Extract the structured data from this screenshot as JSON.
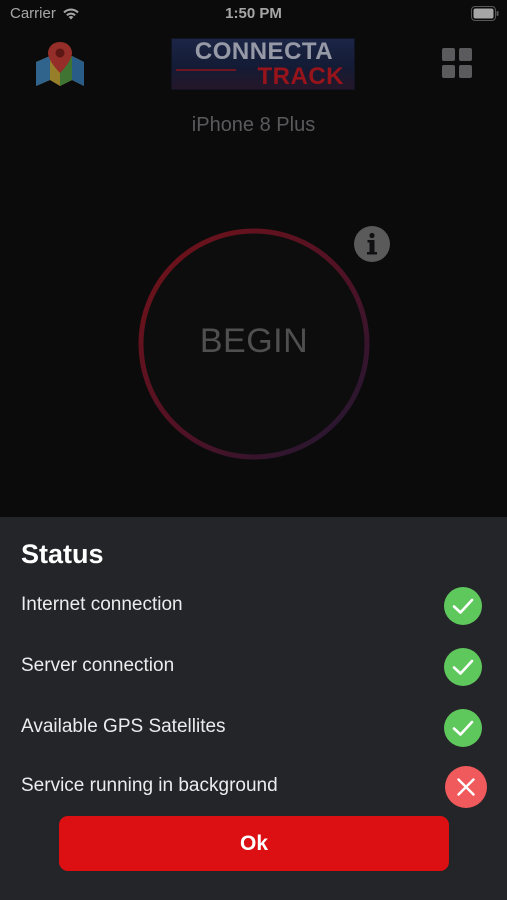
{
  "status_bar": {
    "carrier": "Carrier",
    "time": "1:50 PM"
  },
  "header": {
    "map_icon": "map-pin-icon",
    "logo_top": "CONNECTA",
    "logo_bottom": "TRACK",
    "menu_icon": "grid-icon",
    "device_name": "iPhone 8 Plus"
  },
  "main": {
    "begin_label": "BEGIN",
    "info_icon": "info-icon"
  },
  "status_sheet": {
    "title": "Status",
    "items": [
      {
        "label": "Internet connection",
        "ok": true
      },
      {
        "label": "Server connection",
        "ok": true
      },
      {
        "label": "Available GPS Satellites",
        "ok": true
      },
      {
        "label": "Service running in background",
        "ok": false
      }
    ],
    "ok_label": "Ok"
  },
  "colors": {
    "success": "#5fc85d",
    "error": "#f05a5d",
    "accent": "#dc0f12"
  }
}
